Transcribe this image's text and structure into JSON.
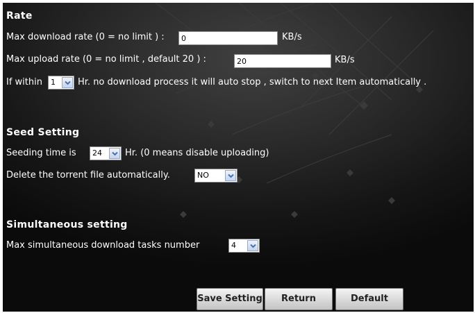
{
  "rate": {
    "heading": "Rate",
    "download_label": "Max download rate (0 = no limit )  :",
    "download_value": "0",
    "download_unit": "KB/s",
    "upload_label": "Max upload rate (0 = no limit , default 20 )  :",
    "upload_value": "20",
    "upload_unit": "KB/s",
    "autostop_prefix": "If within",
    "autostop_value": "1",
    "autostop_suffix": "Hr. no download process it will auto stop , switch to next Item automatically ."
  },
  "seed": {
    "heading": "Seed Setting",
    "time_prefix": "Seeding time is",
    "time_value": "24",
    "time_suffix": "Hr. (0 means disable uploading)",
    "delete_label": "Delete the torrent file automatically.",
    "delete_value": "NO"
  },
  "simultaneous": {
    "heading": "Simultaneous setting",
    "tasks_label": "Max simultaneous download tasks number",
    "tasks_value": "4"
  },
  "buttons": {
    "save": "Save Setting",
    "return": "Return",
    "default": "Default"
  },
  "colors": {
    "background": "#1a1a1a",
    "text": "#ffffff",
    "arrow": "#4a6fb0"
  },
  "icons": {
    "dropdown": "chevron-down-icon"
  }
}
